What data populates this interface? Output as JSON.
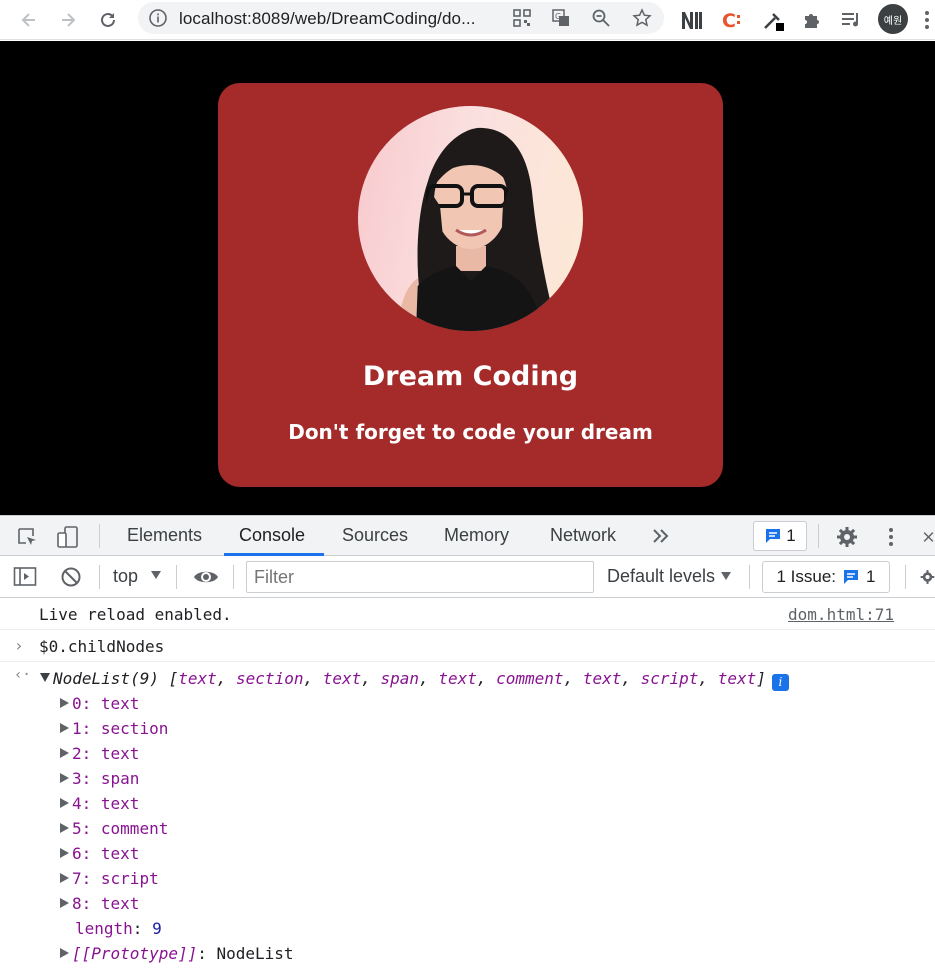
{
  "browser": {
    "url": "localhost:8089/web/DreamCoding/do...",
    "profile_initials": "예원"
  },
  "page": {
    "card_title": "Dream Coding",
    "card_subtitle": "Don't forget to code your dream",
    "card_color": "#a52a2a",
    "photo_alt": "profile photo"
  },
  "devtools": {
    "tabs": [
      {
        "label": "Elements"
      },
      {
        "label": "Console"
      },
      {
        "label": "Sources"
      },
      {
        "label": "Memory"
      },
      {
        "label": "Network"
      }
    ],
    "active_tab": "Console",
    "message_count": "1",
    "context": "top",
    "filter_placeholder": "Filter",
    "levels_label": "Default levels",
    "issues_label": "1 Issue:",
    "issues_count": "1"
  },
  "console": {
    "log_message": "Live reload enabled.",
    "log_source": "dom.html:71",
    "command": "$0.childNodes",
    "nodelist_head": "NodeList(9)",
    "nodelist_preview": [
      "text",
      "section",
      "text",
      "span",
      "text",
      "comment",
      "text",
      "script",
      "text"
    ],
    "items": [
      {
        "index": "0:",
        "value": "text"
      },
      {
        "index": "1:",
        "value": "section"
      },
      {
        "index": "2:",
        "value": "text"
      },
      {
        "index": "3:",
        "value": "span"
      },
      {
        "index": "4:",
        "value": "text"
      },
      {
        "index": "5:",
        "value": "comment"
      },
      {
        "index": "6:",
        "value": "text"
      },
      {
        "index": "7:",
        "value": "script"
      },
      {
        "index": "8:",
        "value": "text"
      }
    ],
    "length_key": "length",
    "length_value": "9",
    "prototype_key": "[[Prototype]]",
    "prototype_value": "NodeList"
  }
}
